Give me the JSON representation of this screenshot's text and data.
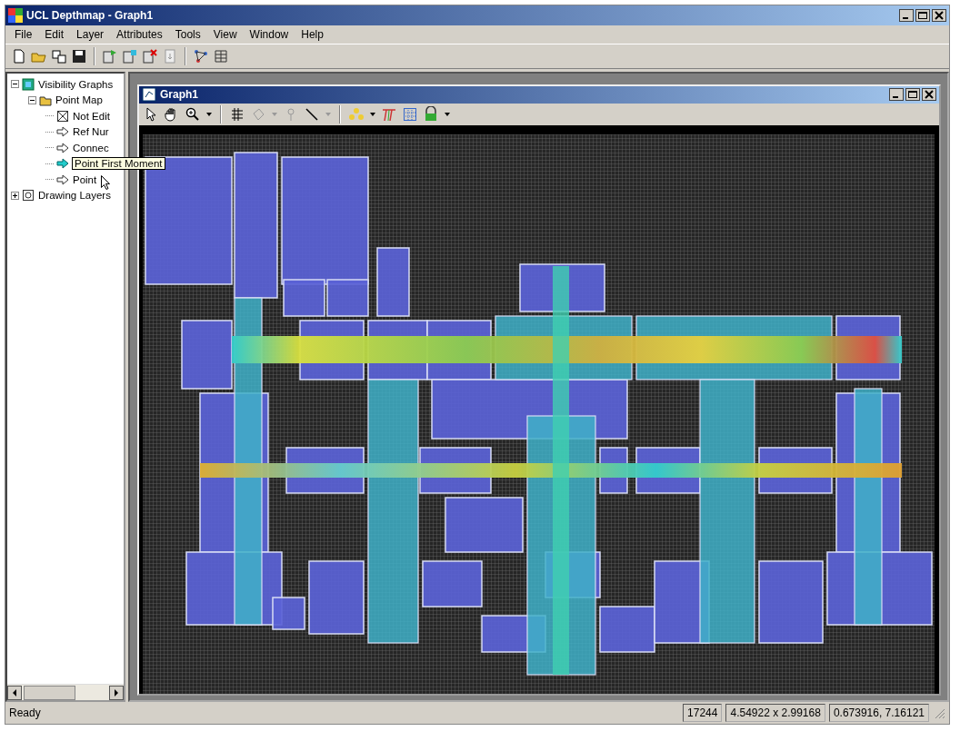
{
  "window": {
    "title": "UCL Depthmap - Graph1"
  },
  "menu": [
    "File",
    "Edit",
    "Layer",
    "Attributes",
    "Tools",
    "View",
    "Window",
    "Help"
  ],
  "tree": [
    {
      "label": "Visibility Graphs",
      "kind": "graph",
      "expanded": true,
      "children": [
        {
          "label": "Point Map",
          "kind": "pointmap",
          "expanded": true,
          "children": [
            {
              "label": "Not Edit",
              "kind": "lock",
              "selected": false
            },
            {
              "label": "Ref Nur",
              "kind": "attribute",
              "selected": false
            },
            {
              "label": "Connec",
              "kind": "attribute",
              "selected": false
            },
            {
              "label": "Point First Moment",
              "kind": "attribute",
              "selected": true
            },
            {
              "label": "Point",
              "kind": "attribute",
              "selected": false
            }
          ]
        }
      ]
    },
    {
      "label": "Drawing Layers",
      "kind": "drawing",
      "expanded": false
    }
  ],
  "child_window": {
    "title": "Graph1"
  },
  "status_bar": {
    "message": "Ready",
    "panes": [
      "17244",
      "4.54922 x 2.99168",
      "0.673916, 7.16121"
    ]
  }
}
